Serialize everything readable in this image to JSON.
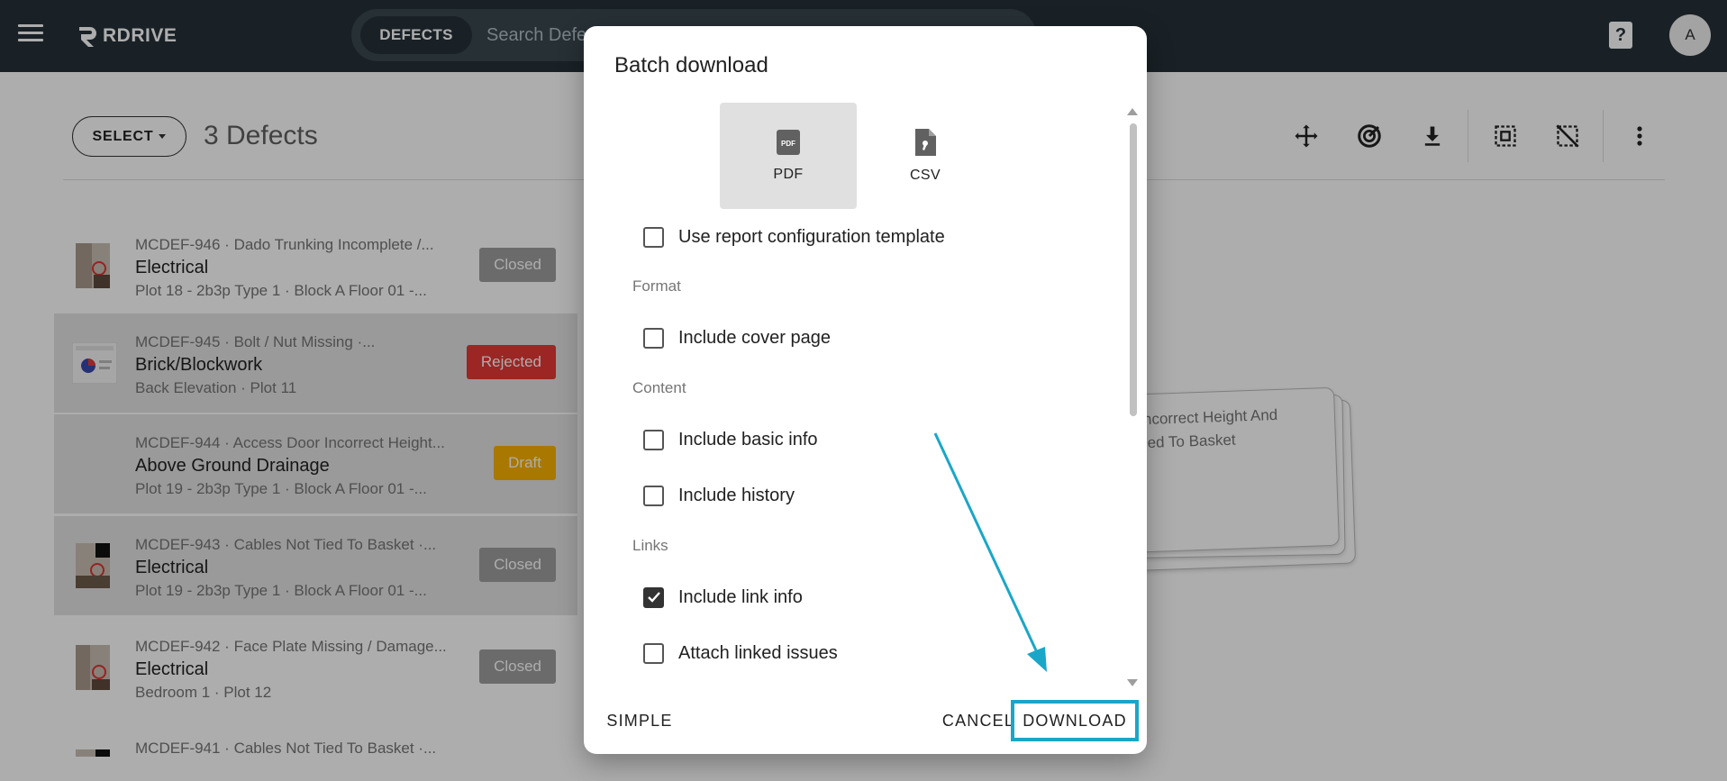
{
  "app": {
    "name": "RDRIVE"
  },
  "search": {
    "chip": "DEFECTS",
    "placeholder": "Search Defects"
  },
  "user": {
    "avatar_initial": "A"
  },
  "help": {
    "symbol": "?"
  },
  "toolbar": {
    "select_label": "SELECT",
    "count_label": "3 Defects",
    "icons": [
      "move-icon",
      "radar-icon",
      "download-icon",
      "select-all-icon",
      "deselect-icon",
      "more-vert-icon"
    ]
  },
  "defects": [
    {
      "title": "MCDEF-946 · Dado Trunking Incomplete /...",
      "category": "Electrical",
      "location": "Plot 18 - 2b3p Type 1 · Block A Floor 01 -...",
      "status": "Closed",
      "selected": false
    },
    {
      "title": "MCDEF-945 · Bolt / Nut Missing ·...",
      "category": "Brick/Blockwork",
      "location": "Back Elevation · Plot 11",
      "status": "Rejected",
      "selected": true
    },
    {
      "title": "MCDEF-944 · Access Door Incorrect Height...",
      "category": "Above Ground Drainage",
      "location": "Plot 19 - 2b3p Type 1 · Block A Floor 01 -...",
      "status": "Draft",
      "selected": true
    },
    {
      "title": "MCDEF-943 · Cables Not Tied To Basket ·...",
      "category": "Electrical",
      "location": "Plot 19 - 2b3p Type 1 · Block A Floor 01 -...",
      "status": "Closed",
      "selected": true
    },
    {
      "title": "MCDEF-942 · Face Plate Missing / Damage...",
      "category": "Electrical",
      "location": "Bedroom 1 · Plot 12",
      "status": "Closed",
      "selected": false
    },
    {
      "title": "MCDEF-941 · Cables Not Tied To Basket ·...",
      "category": "",
      "location": "",
      "status": "",
      "selected": false
    }
  ],
  "background_card": {
    "line1": "ncorrect Height And",
    "line2": "ied To Basket"
  },
  "dialog": {
    "title": "Batch download",
    "formats": [
      {
        "label": "PDF",
        "icon": "pdf-file-icon",
        "active": true
      },
      {
        "label": "CSV",
        "icon": "csv-file-icon",
        "active": false
      }
    ],
    "use_template_label": "Use report configuration template",
    "sections": {
      "format": "Format",
      "content": "Content",
      "links": "Links"
    },
    "options": {
      "cover_page": "Include cover page",
      "basic_info": "Include basic info",
      "history": "Include history",
      "link_info": "Include link info",
      "linked_issues": "Attach linked issues"
    },
    "buttons": {
      "simple": "SIMPLE",
      "cancel": "CANCEL",
      "download": "DOWNLOAD"
    }
  },
  "colors": {
    "topbar": "#263238",
    "highlight": "#1aa6c8",
    "closed": "#9e9e9e",
    "rejected": "#e53935",
    "draft": "#f9b100"
  }
}
